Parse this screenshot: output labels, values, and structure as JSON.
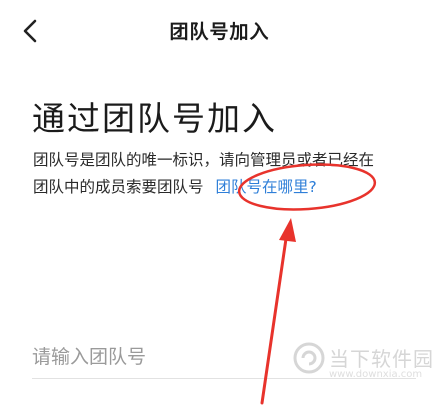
{
  "header": {
    "back_icon": "chevron-left-icon",
    "title": "团队号加入"
  },
  "main": {
    "title": "通过团队号加入",
    "description_line1": "团队号是团队的唯一标识，请向管理员或者已经在",
    "description_line2": "团队中的成员索要团队号",
    "help_link": "团队号在哪里?",
    "input_placeholder": "请输入团队号",
    "input_value": ""
  },
  "annotation": {
    "color": "#e8332c",
    "shapes": [
      "ellipse",
      "arrow"
    ]
  },
  "watermark": {
    "name": "当下软件园",
    "url": "www.downxia.com",
    "logo_icon": "downxia-logo-icon"
  },
  "colors": {
    "link": "#2f7fd8",
    "text": "#222222",
    "placeholder": "#9a9a9a"
  }
}
